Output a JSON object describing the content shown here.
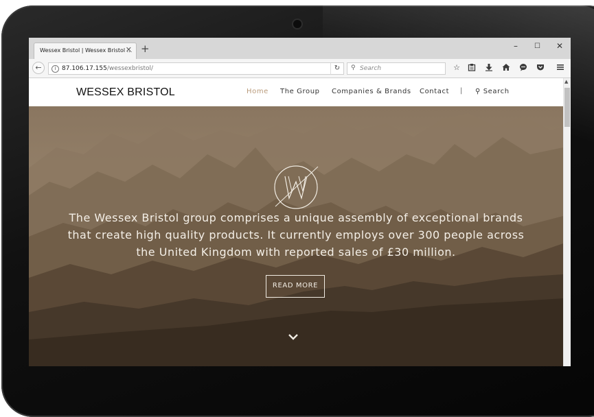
{
  "browser": {
    "tab_title": "Wessex Bristol | Wessex Bristol ...",
    "tab_close": "✕",
    "new_tab": "+",
    "window_controls": {
      "minimize": "–",
      "maximize": "☐",
      "close": "✕"
    },
    "url_host": "87.106.17.155",
    "url_path": "/wessexbristol/",
    "search_placeholder": "Search",
    "toolbar_icons": [
      "bookmark-star-icon",
      "clipboard-icon",
      "download-icon",
      "home-icon",
      "chat-icon",
      "pocket-icon",
      "menu-icon"
    ]
  },
  "site": {
    "logo": "WESSEX BRISTOL",
    "nav": [
      {
        "label": "Home",
        "active": true
      },
      {
        "label": "The Group",
        "active": false
      },
      {
        "label": "Companies & Brands",
        "active": false
      },
      {
        "label": "Contact",
        "active": false
      }
    ],
    "nav_separator": "|",
    "nav_search": "Search",
    "hero": {
      "line1": "The Wessex Bristol group comprises a unique assembly of exceptional brands",
      "line2": "that create high quality products. It currently employs over 300 people across",
      "line3": "the United Kingdom with reported sales of £30 million.",
      "button": "READ MORE"
    }
  },
  "colors": {
    "nav_active": "#b99a7a",
    "hero_sky": "#8d7a62",
    "hero_dark": "#3b2f23"
  }
}
